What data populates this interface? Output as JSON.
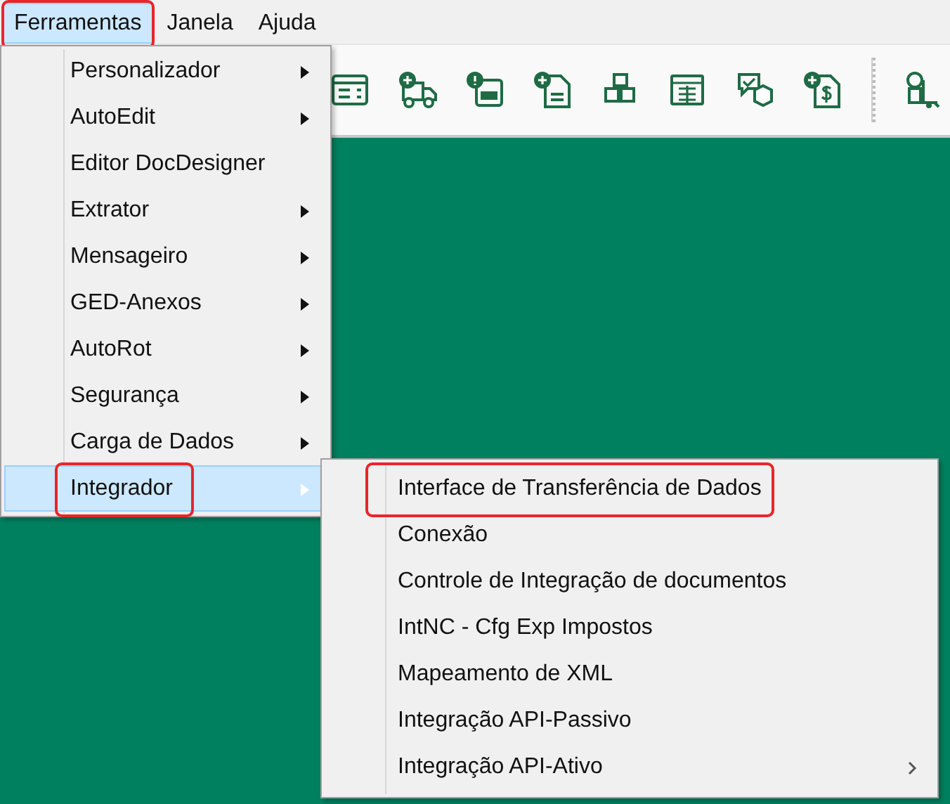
{
  "menu_bar": [
    {
      "label": "Ferramentas",
      "selected": true,
      "annotated": true
    },
    {
      "label": "Janela",
      "selected": false,
      "annotated": false
    },
    {
      "label": "Ajuda",
      "selected": false,
      "annotated": false
    }
  ],
  "menu": {
    "items": [
      {
        "label": "Personalizador",
        "submenu": true,
        "selected": false,
        "annotated": false
      },
      {
        "label": "AutoEdit",
        "submenu": true,
        "selected": false,
        "annotated": false
      },
      {
        "label": "Editor DocDesigner",
        "submenu": false,
        "selected": false,
        "annotated": false
      },
      {
        "label": "Extrator",
        "submenu": true,
        "selected": false,
        "annotated": false
      },
      {
        "label": "Mensageiro",
        "submenu": true,
        "selected": false,
        "annotated": false
      },
      {
        "label": "GED-Anexos",
        "submenu": true,
        "selected": false,
        "annotated": false
      },
      {
        "label": "AutoRot",
        "submenu": true,
        "selected": false,
        "annotated": false
      },
      {
        "label": "Segurança",
        "submenu": true,
        "selected": false,
        "annotated": false
      },
      {
        "label": "Carga de Dados",
        "submenu": true,
        "selected": false,
        "annotated": false
      },
      {
        "label": "Integrador",
        "submenu": true,
        "selected": true,
        "annotated": true
      }
    ]
  },
  "submenu": {
    "items": [
      {
        "label": "Interface de Transferência de Dados",
        "submenu": false,
        "selected": false,
        "annotated": true
      },
      {
        "label": "Conexão",
        "submenu": false,
        "selected": false,
        "annotated": false
      },
      {
        "label": "Controle de Integração de documentos",
        "submenu": false,
        "selected": false,
        "annotated": false
      },
      {
        "label": "IntNC - Cfg Exp Impostos",
        "submenu": false,
        "selected": false,
        "annotated": false
      },
      {
        "label": "Mapeamento de XML",
        "submenu": false,
        "selected": false,
        "annotated": false
      },
      {
        "label": "Integração API-Passivo",
        "submenu": false,
        "selected": false,
        "annotated": false
      },
      {
        "label": "Integração API-Ativo",
        "submenu": true,
        "selected": false,
        "annotated": false
      }
    ]
  }
}
